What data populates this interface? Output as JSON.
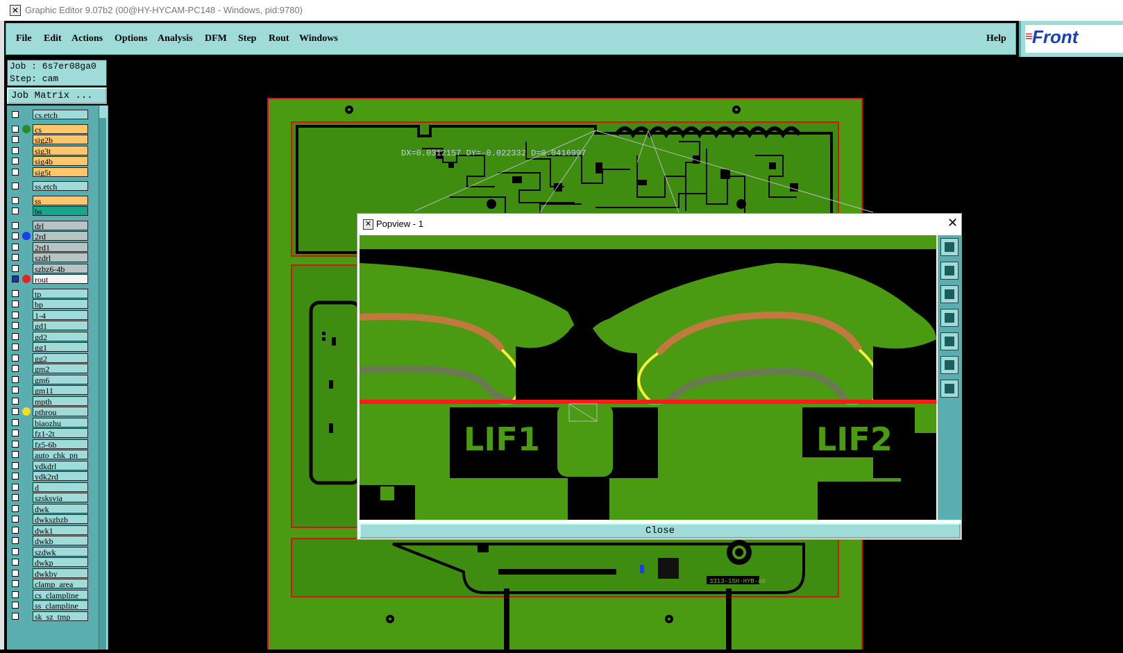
{
  "window": {
    "title": "Graphic Editor 9.07b2 (00@HY-HYCAM-PC148 - Windows, pid:9780)",
    "icon": "x-app-icon"
  },
  "menu": {
    "items": [
      {
        "label": "File"
      },
      {
        "label": "Edit"
      },
      {
        "label": "Actions"
      },
      {
        "label": "Options"
      },
      {
        "label": "Analysis"
      },
      {
        "label": "DFM"
      },
      {
        "label": "Step"
      },
      {
        "label": "Rout"
      },
      {
        "label": "Windows"
      }
    ],
    "help": "Help",
    "logo_text": "Front"
  },
  "job": {
    "job_line": "Job : 6s7er08ga0",
    "step_line": "Step: cam",
    "matrix_button": "Job Matrix ..."
  },
  "layers": [
    {
      "name": "cs.etch",
      "color": "#9edbd9",
      "dot": ""
    },
    {
      "name": "cs",
      "color": "#ffc66b",
      "dot": "#2a8a2a"
    },
    {
      "name": "sig2b",
      "color": "#ffc66b",
      "dot": ""
    },
    {
      "name": "sig3t",
      "color": "#ffc66b",
      "dot": ""
    },
    {
      "name": "sig4b",
      "color": "#ffc66b",
      "dot": ""
    },
    {
      "name": "sig5t",
      "color": "#ffc66b",
      "dot": ""
    },
    {
      "name": "ss.etch",
      "color": "#9edbd9",
      "dot": ""
    },
    {
      "name": "ss",
      "color": "#ffc66b",
      "dot": ""
    },
    {
      "name": "bs",
      "color": "#1aa58f",
      "dot": ""
    },
    {
      "name": "drl",
      "color": "#b6c4c6",
      "dot": ""
    },
    {
      "name": "2rd",
      "color": "#b6c4c6",
      "dot": "#1a3fe8"
    },
    {
      "name": "2rd1",
      "color": "#b6c4c6",
      "dot": ""
    },
    {
      "name": "szdrl",
      "color": "#b6c4c6",
      "dot": ""
    },
    {
      "name": "szbz6-4b",
      "color": "#b6c4c6",
      "dot": ""
    },
    {
      "name": "rout",
      "color": "#f4f4f4",
      "dot": "#e82222",
      "checked": true
    },
    {
      "name": "tp",
      "color": "#9edbd9",
      "dot": ""
    },
    {
      "name": "bp",
      "color": "#9edbd9",
      "dot": ""
    },
    {
      "name": "1-4",
      "color": "#9edbd9",
      "dot": ""
    },
    {
      "name": "gd1",
      "color": "#9edbd9",
      "dot": ""
    },
    {
      "name": "gd2",
      "color": "#9edbd9",
      "dot": ""
    },
    {
      "name": "gg1",
      "color": "#9edbd9",
      "dot": ""
    },
    {
      "name": "gg2",
      "color": "#9edbd9",
      "dot": ""
    },
    {
      "name": "gm2",
      "color": "#9edbd9",
      "dot": ""
    },
    {
      "name": "gm6",
      "color": "#9edbd9",
      "dot": ""
    },
    {
      "name": "gm11",
      "color": "#9edbd9",
      "dot": ""
    },
    {
      "name": "mpth",
      "color": "#9edbd9",
      "dot": ""
    },
    {
      "name": "pthrou",
      "color": "#9edbd9",
      "dot": "#f2e020"
    },
    {
      "name": "biaozhu",
      "color": "#9edbd9",
      "dot": ""
    },
    {
      "name": "fz1-2t",
      "color": "#9edbd9",
      "dot": ""
    },
    {
      "name": "fz5-6b",
      "color": "#9edbd9",
      "dot": ""
    },
    {
      "name": "auto_chk_pn",
      "color": "#9edbd9",
      "dot": ""
    },
    {
      "name": "ydkdrl",
      "color": "#9edbd9",
      "dot": ""
    },
    {
      "name": "ydk2rd",
      "color": "#9edbd9",
      "dot": ""
    },
    {
      "name": "d",
      "color": "#9edbd9",
      "dot": ""
    },
    {
      "name": "szsksvia",
      "color": "#9edbd9",
      "dot": ""
    },
    {
      "name": "dwk",
      "color": "#9edbd9",
      "dot": ""
    },
    {
      "name": "dwkszbzb",
      "color": "#9edbd9",
      "dot": ""
    },
    {
      "name": "dwk1",
      "color": "#9edbd9",
      "dot": ""
    },
    {
      "name": "dwkb",
      "color": "#9edbd9",
      "dot": ""
    },
    {
      "name": "szdwk",
      "color": "#9edbd9",
      "dot": ""
    },
    {
      "name": "dwkp",
      "color": "#9edbd9",
      "dot": ""
    },
    {
      "name": "dwkby",
      "color": "#9edbd9",
      "dot": ""
    },
    {
      "name": "clamp_area",
      "color": "#9edbd9",
      "dot": ""
    },
    {
      "name": "cs_clampline",
      "color": "#9edbd9",
      "dot": ""
    },
    {
      "name": "ss_clampline",
      "color": "#9edbd9",
      "dot": ""
    },
    {
      "name": "sk_sz_tmp",
      "color": "#9edbd9",
      "dot": ""
    }
  ],
  "measurement_text": "DX=0.0312157 DY=-0.022332 D=0.0416997",
  "popview": {
    "title": "Popview - 1",
    "close_label": "Close",
    "labels": [
      "LIF1",
      "LIF2"
    ],
    "tools": [
      "zoom-fit-icon",
      "pan-up-icon",
      "pan-down-icon",
      "pan-left-icon",
      "pan-right-icon",
      "zoom-in-icon",
      "zoom-out-icon"
    ]
  },
  "board_label": "3313-1SH-HYB-A0",
  "colors": {
    "board_green": "#4a9a12",
    "panel_cyan": "#9edbd9",
    "rout_red": "#ff1a1a",
    "highlight_yellow": "#f7ef3a"
  }
}
